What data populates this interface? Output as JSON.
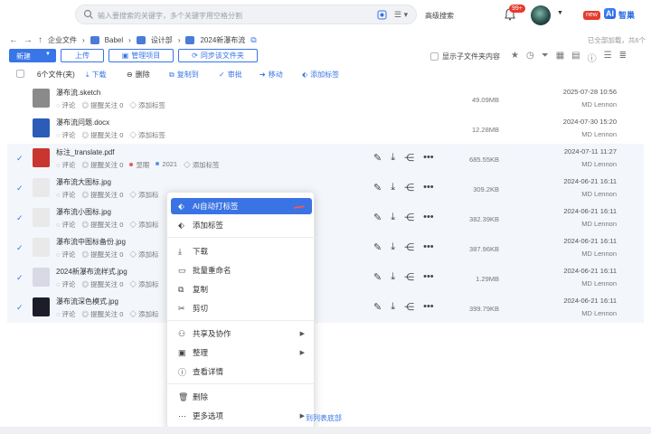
{
  "search": {
    "placeholder": "输入要搜索的关键字，多个关键字用空格分割"
  },
  "header": {
    "advanced_search": "高级搜索",
    "notification_count": "99+",
    "new_badge": "new",
    "ai_logo": "AI",
    "ai_label": "智巢"
  },
  "breadcrumb": {
    "root": "企业文件",
    "items": [
      "Babel",
      "设计部",
      "2024新瀑布流"
    ]
  },
  "status": {
    "loaded": "已全部加载，共6个"
  },
  "toolbar": {
    "new_label": "新建",
    "upload": "上传",
    "manage": "管理项目",
    "sync": "同步该文件夹",
    "show_sub": "显示子文件夹内容"
  },
  "actions": {
    "count": "6个文件(夹)",
    "download": "下载",
    "delete": "删除",
    "copy_to": "复制到",
    "approve": "审批",
    "move": "移动",
    "add_tag": "添加标签"
  },
  "files": [
    {
      "name": "瀑布流.sketch",
      "comment": "评论",
      "follow": "提醒关注 0",
      "tag": "添加标签",
      "size": "49.09MB",
      "date": "2025-07-28 10:56",
      "owner": "MD Lennon",
      "selected": false,
      "thumb": "#8a8a8a"
    },
    {
      "name": "瀑布流问题.docx",
      "comment": "评论",
      "follow": "提醒关注 0",
      "tag": "添加标签",
      "size": "12.28MB",
      "date": "2024-07-30 15:20",
      "owner": "MD Lennon",
      "selected": false,
      "thumb": "#2b5cb8"
    },
    {
      "name": "标注_translate.pdf",
      "comment": "评论",
      "follow": "提醒关注 0",
      "tag1": "显眼",
      "tag2": "2021",
      "tag": "添加标签",
      "size": "685.55KB",
      "date": "2024-07-11 11:27",
      "owner": "MD Lennon",
      "selected": true,
      "thumb": "#c8362f"
    },
    {
      "name": "瀑布流大图标.jpg",
      "comment": "评论",
      "follow": "提醒关注 0",
      "tag": "添加标",
      "size": "309.2KB",
      "date": "2024-06-21 16:11",
      "owner": "MD Lennon",
      "selected": true,
      "thumb": "#e9e9e9"
    },
    {
      "name": "瀑布流小图标.jpg",
      "comment": "评论",
      "follow": "提醒关注 0",
      "tag": "添加标",
      "size": "382.39KB",
      "date": "2024-06-21 16:11",
      "owner": "MD Lennon",
      "selected": true,
      "thumb": "#e9e9e9"
    },
    {
      "name": "瀑布流中图标备份.jpg",
      "comment": "评论",
      "follow": "提醒关注 0",
      "tag": "添加标",
      "size": "387.96KB",
      "date": "2024-06-21 16:11",
      "owner": "MD Lennon",
      "selected": true,
      "thumb": "#e9e9e9"
    },
    {
      "name": "2024新瀑布流样式.jpg",
      "comment": "评论",
      "follow": "提醒关注 0",
      "tag": "添加标",
      "size": "1.29MB",
      "date": "2024-06-21 16:11",
      "owner": "MD Lennon",
      "selected": true,
      "thumb": "#d9d9e6"
    },
    {
      "name": "瀑布流深色模式.jpg",
      "comment": "评论",
      "follow": "提醒关注 0",
      "tag": "添加标",
      "size": "399.79KB",
      "date": "2024-06-21 16:11",
      "owner": "MD Lennon",
      "selected": true,
      "thumb": "#1d1d2a"
    }
  ],
  "context_menu": {
    "ai_tag": "AI自动打标签",
    "add_tag": "添加标签",
    "download": "下载",
    "batch_rename": "批量重命名",
    "copy": "复制",
    "cut": "剪切",
    "share": "共享及协作",
    "organize": "整理",
    "details": "查看详情",
    "delete": "删除",
    "more": "更多选项"
  },
  "footer": {
    "list_bottom": "到列表底部"
  },
  "colors": {
    "accent": "#3875e8",
    "menu_highlight": "#3a73e3",
    "selected_row": "#f3f6fb"
  }
}
